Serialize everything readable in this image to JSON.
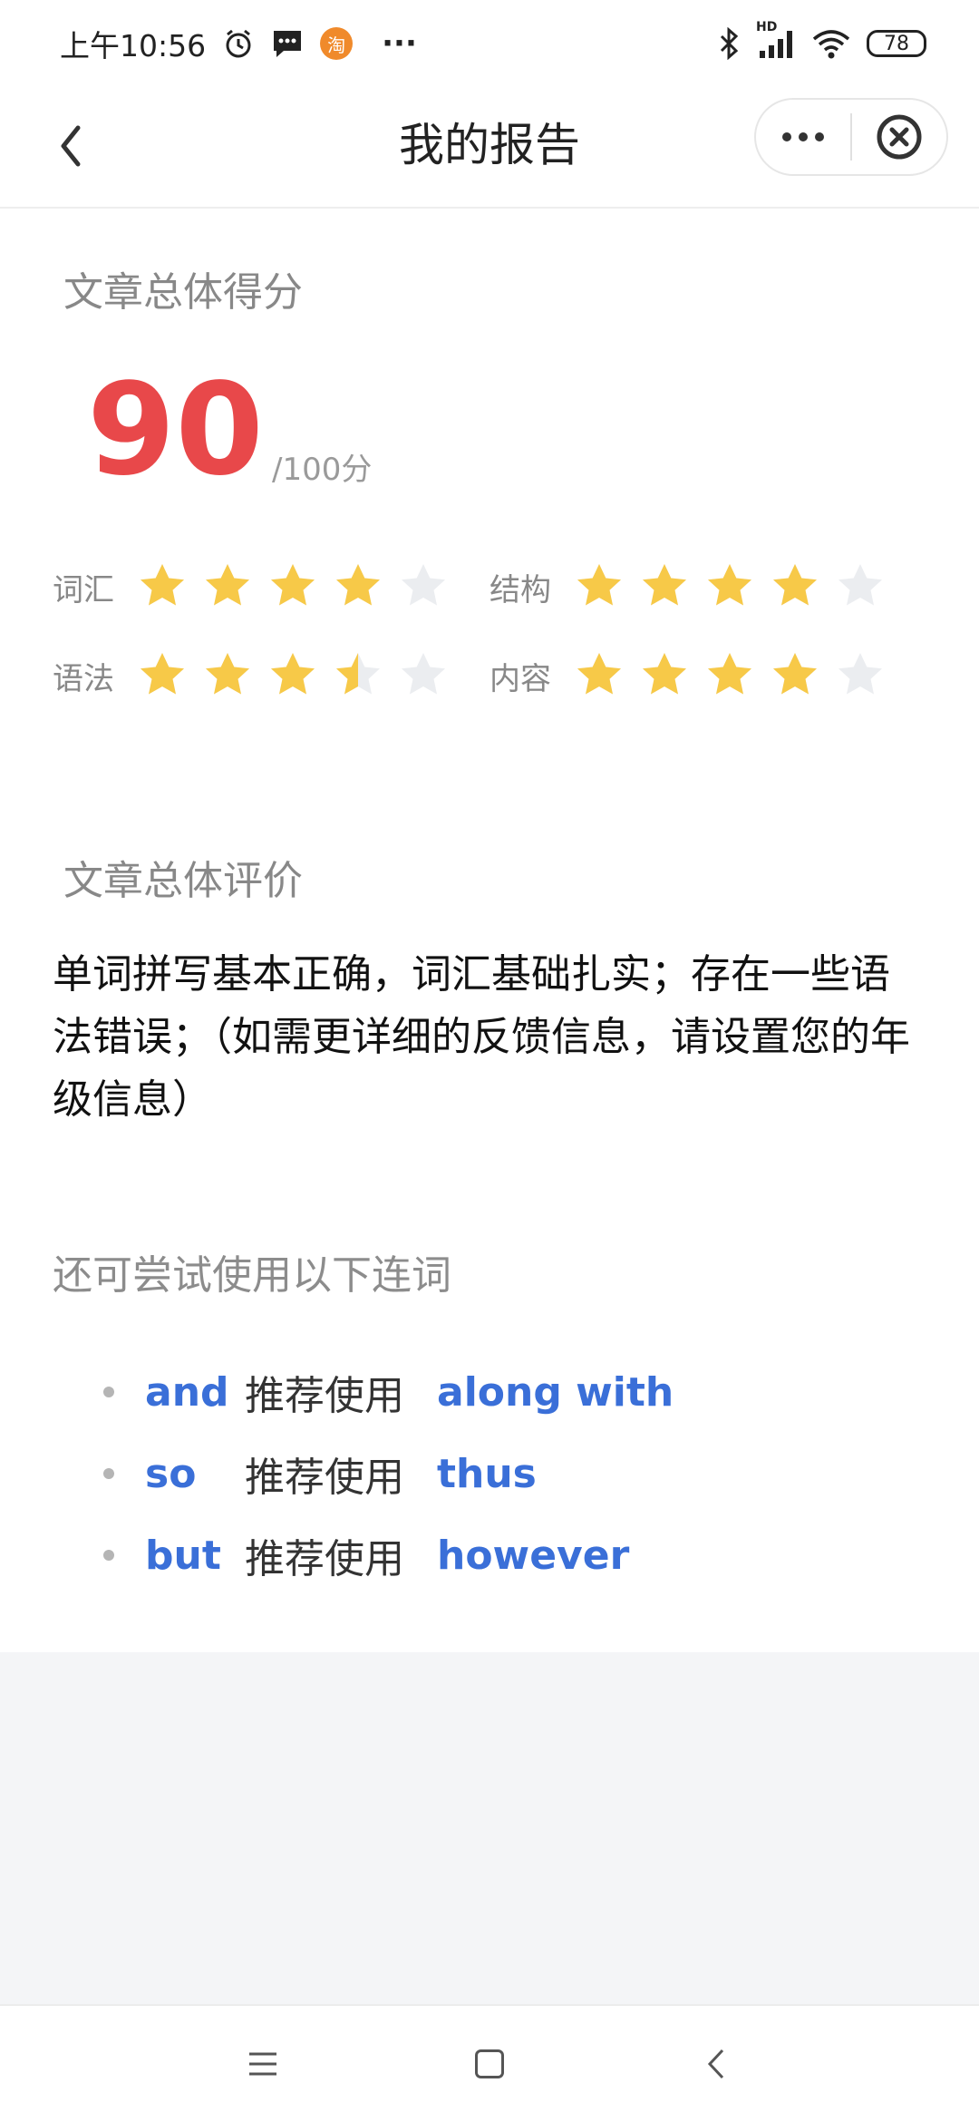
{
  "status_bar": {
    "time": "上午10:56",
    "app_badge": "淘",
    "more": "···",
    "network": "HD",
    "battery": "78"
  },
  "header": {
    "title": "我的报告"
  },
  "score_section": {
    "heading": "文章总体得分",
    "score": "90",
    "total": "/100分"
  },
  "ratings": [
    {
      "label": "词汇",
      "stars": 4,
      "max": 5
    },
    {
      "label": "结构",
      "stars": 4,
      "max": 5
    },
    {
      "label": "语法",
      "stars": 3.5,
      "max": 5
    },
    {
      "label": "内容",
      "stars": 4,
      "max": 5
    }
  ],
  "evaluation": {
    "heading": "文章总体评价",
    "text": "单词拼写基本正确，词汇基础扎实；存在一些语法错误；（如需更详细的反馈信息，请设置您的年级信息）"
  },
  "conjunctions": {
    "heading": "还可尝试使用以下连词",
    "items": [
      {
        "word": "and",
        "recommend": "推荐使用",
        "suggestion": "along with"
      },
      {
        "word": "so",
        "recommend": "推荐使用",
        "suggestion": "thus"
      },
      {
        "word": "but",
        "recommend": "推荐使用",
        "suggestion": "however"
      }
    ]
  },
  "colors": {
    "score": "#e8484a",
    "star_filled": "#f7c948",
    "star_empty": "#ebedf0",
    "link": "#3a6fd8"
  }
}
